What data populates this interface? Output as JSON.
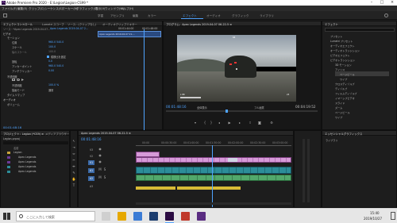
{
  "window": {
    "title": "Adobe Premiere Pro 2020 - E:\\Legion\\Legion-CS99 *"
  },
  "menu": [
    "ファイル(F)",
    "編集(E)",
    "クリップ(C)",
    "シーケンス(S)",
    "マーカー(M)",
    "グラフィック(G)",
    "表示(V)",
    "ウィンドウ(W)",
    "ヘルプ(H)"
  ],
  "workspaces": [
    "学習",
    "アセンブリ",
    "編集",
    "カラー",
    "エフェクト",
    "オーディオ",
    "グラフィック",
    "ライブラリ"
  ],
  "effect_controls": {
    "tabs": [
      "エフェクトコントロール",
      "Lumetri スコープ",
      "ソース：(クリップなし)",
      "オーディオクリップミキサー"
    ],
    "clip": "ソース・*Apex Legends 2019-04-07...",
    "seq": "Apex Legends 2019-04-07 2...",
    "timecode_head": "00:01:44:00",
    "timecode_head2": "00:01:48:00",
    "clip_label": "Apex Legends 2019-04-07 21-...",
    "section_video": "ビデオ",
    "rows": [
      {
        "label": "モーション",
        "value": ""
      },
      {
        "label": "位置",
        "value": "960.0    540.0"
      },
      {
        "label": "スケール",
        "value": "100.0"
      },
      {
        "label": "幅のスケール",
        "value": "100.0"
      },
      {
        "label": "縦横比を固定",
        "value": ""
      },
      {
        "label": "回転",
        "value": "0.0"
      },
      {
        "label": "アンカーポイント",
        "value": "960.0    540.0"
      },
      {
        "label": "アンチフリッカー",
        "value": "0.00"
      },
      {
        "label": "不透明度",
        "value": ""
      },
      {
        "label": "不透明度",
        "value": "100.0 %"
      },
      {
        "label": "描画モード",
        "value": "通常"
      },
      {
        "label": "タイムリマップ",
        "value": ""
      }
    ],
    "section_audio": "オーディオ",
    "audio_row": "ボリューム",
    "timecode": "00:01:48:16"
  },
  "program": {
    "title": "プログラム：Apex Legends 2019-04-07 06-22-5 ≡",
    "timecode": "00:01:48:16",
    "fit": "全体表示",
    "quality": "フル画質",
    "duration": "00:04:19:52",
    "hud_top": "68",
    "hud_ammo": "23",
    "hud_left": "L 88"
  },
  "effects": {
    "title": "エフェクト",
    "items": [
      "プリセット",
      "Lumetri プリセット",
      "オーディオエフェクト",
      "オーディオトランジション",
      "ビデオエフェクト",
      "ビデオトランジション",
      "3D モーション",
      "アイリス",
      "ページピール",
      "ワイプ",
      "クロスディゾルブ",
      "ディゾルブ",
      "フィルムディゾルブ",
      "イマーシブビデオ",
      "スライド",
      "ズーム",
      "ページピール",
      "ワイプ"
    ],
    "lower_title": "エッセンシャルグラフィックス",
    "lower_item": "ライブラリ"
  },
  "project": {
    "title": "プロジェクト：Legion (*CS9) ≡",
    "tab2": "メディアブラウザー",
    "file": "Legion.prproj",
    "items": [
      "名前",
      "Legion",
      "Apex Legends",
      "Apex Legends",
      "Apex Legends",
      "Apex Legends"
    ]
  },
  "timeline": {
    "title": "Apex Legends 2019-04-07 06-22-5 ≡",
    "timecode": "00:01:48:16",
    "ruler": [
      "00:00",
      "00:00:30:00",
      "00:01:00:00",
      "00:01:30:00",
      "00:02:00:00",
      "00:02:30:00",
      "00:03:00:00"
    ],
    "tracks": [
      "V3",
      "V2",
      "V1",
      "A1",
      "A2",
      "A3"
    ]
  },
  "taskbar": {
    "search": "ここに入力して検索",
    "time": "15:40",
    "date": "2019/10/27"
  }
}
